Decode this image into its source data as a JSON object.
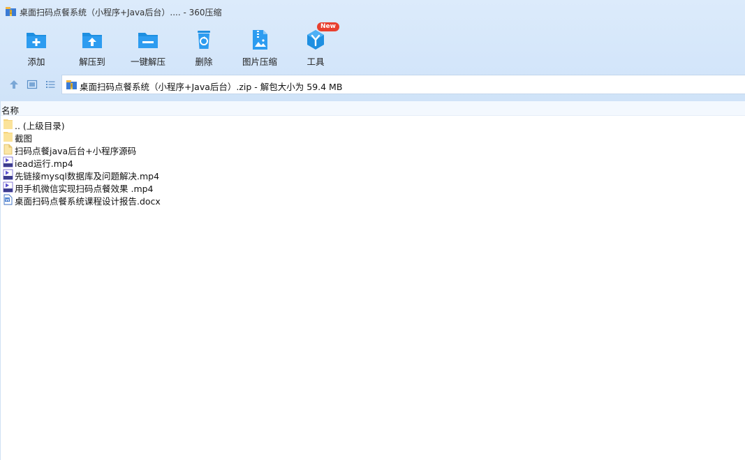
{
  "window": {
    "title": "桌面扫码点餐系统（小程序+Java后台）.... - 360压缩",
    "app_icon": "archive-icon"
  },
  "toolbar": {
    "buttons": [
      {
        "label": "添加",
        "icon": "folder-plus-icon"
      },
      {
        "label": "解压到",
        "icon": "folder-extract-icon"
      },
      {
        "label": "一键解压",
        "icon": "folder-oneclick-icon"
      },
      {
        "label": "删除",
        "icon": "recycle-bin-icon"
      },
      {
        "label": "图片压缩",
        "icon": "image-compress-icon"
      },
      {
        "label": "工具",
        "icon": "tools-cube-icon"
      }
    ],
    "new_badge": "New"
  },
  "address": {
    "text": "桌面扫码点餐系统（小程序+Java后台）.zip - 解包大小为 59.4 MB"
  },
  "list": {
    "header": "名称",
    "items": [
      {
        "name": ".. (上级目录)",
        "type": "folder"
      },
      {
        "name": "截图",
        "type": "folder"
      },
      {
        "name": "扫码点餐java后台+小程序源码",
        "type": "file"
      },
      {
        "name": "iead运行.mp4",
        "type": "video"
      },
      {
        "name": "先链接mysql数据库及问题解决.mp4",
        "type": "video"
      },
      {
        "name": "用手机微信实现扫码点餐效果 .mp4",
        "type": "video"
      },
      {
        "name": "桌面扫码点餐系统课程设计报告.docx",
        "type": "word"
      }
    ]
  },
  "colors": {
    "accent": "#1e8fe1",
    "chrome_bg": "#d4e6fa",
    "badge": "#e8402f"
  }
}
